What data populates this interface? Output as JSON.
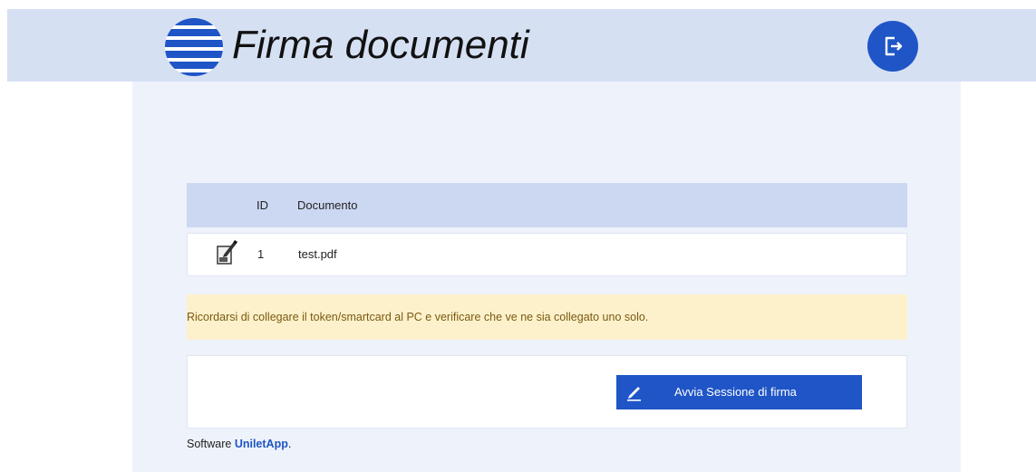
{
  "header": {
    "title": "Firma documenti",
    "logo_icon": "striped-circle-logo",
    "logout_icon": "logout-icon",
    "accent_color": "#1f55c6"
  },
  "table": {
    "headers": [
      "ID",
      "Documento"
    ],
    "rows": [
      {
        "icon": "pdf-sign-icon",
        "id": "1",
        "document": "test.pdf"
      }
    ]
  },
  "alert": {
    "message": "Ricordarsi di collegare il token/smartcard al PC e verificare che ve ne sia collegato uno solo."
  },
  "actions": {
    "start_session_label": "Avvia Sessione di firma",
    "start_session_icon": "pen-icon"
  },
  "footer": {
    "prefix": "Software ",
    "brand": "UniletApp",
    "suffix": "."
  }
}
